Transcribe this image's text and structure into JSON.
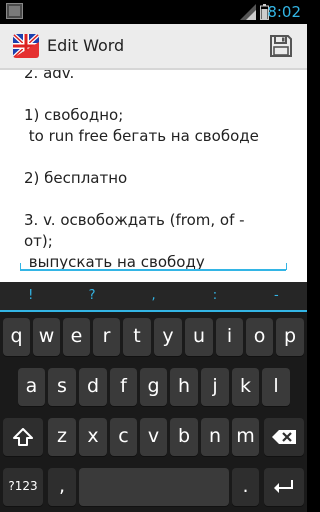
{
  "status_bar": {
    "time": "8:02"
  },
  "action_bar": {
    "title": "Edit Word"
  },
  "editor": {
    "text": "2. adv.\n\n1) свободно;\n to run free бегать на свободе\n\n2) бесплатно\n\n3. v. освобождать (from, of -\nот);\n выпускать на свободу"
  },
  "keyboard": {
    "symbols": [
      "!",
      "?",
      ",",
      ":",
      "-"
    ],
    "row1": [
      "q",
      "w",
      "e",
      "r",
      "t",
      "y",
      "u",
      "i",
      "o",
      "p"
    ],
    "row2": [
      "a",
      "s",
      "d",
      "f",
      "g",
      "h",
      "j",
      "k",
      "l"
    ],
    "row3": [
      "z",
      "x",
      "c",
      "v",
      "b",
      "n",
      "m"
    ],
    "numbers_key": "?123",
    "comma_key": ",",
    "period_key": "."
  },
  "colors": {
    "accent": "#33b5e5",
    "action_bar": "#ececec",
    "keyboard_bg": "#1a1a1a",
    "key_bg": "#3a3a3a"
  }
}
